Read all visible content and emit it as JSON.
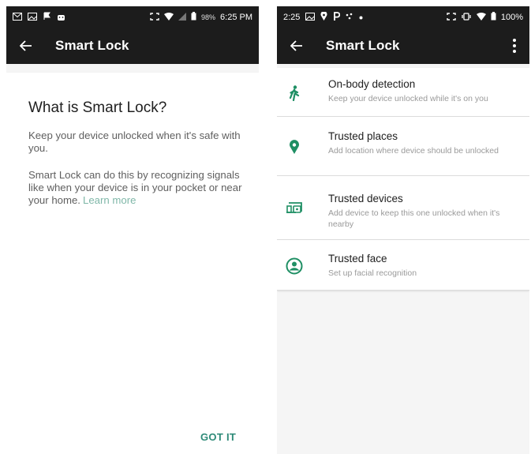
{
  "colors": {
    "toolbar": "#1c1c1c",
    "accent": "#2e8a78",
    "icon_green": "#1f8f64",
    "text_primary": "#202020",
    "text_secondary": "#5f5f5f"
  },
  "left_screen": {
    "status_bar": {
      "left_icons": [
        "mail-icon",
        "image-icon",
        "flag-icon",
        "android-icon"
      ],
      "right_icons": [
        "fullscreen-icon",
        "wifi-icon",
        "signal-icon",
        "battery-icon"
      ],
      "battery": "98%",
      "time": "6:25 PM"
    },
    "app_bar": {
      "title": "Smart Lock"
    },
    "card": {
      "heading": "What is Smart Lock?",
      "paragraph1": "Keep your device unlocked when it's safe with you.",
      "paragraph2": "Smart Lock can do this by recognizing signals like when your device is in your pocket or near your home.",
      "learn_more": "Learn more",
      "got_it": "GOT IT"
    }
  },
  "right_screen": {
    "status_bar": {
      "time": "2:25",
      "left_icons": [
        "image-icon",
        "location-icon",
        "parking-icon",
        "app-icon",
        "dot-icon"
      ],
      "right_icons": [
        "fullscreen-icon",
        "vibrate-icon",
        "wifi-icon",
        "battery-icon"
      ],
      "battery": "100%"
    },
    "app_bar": {
      "title": "Smart Lock"
    },
    "items": [
      {
        "title": "On-body detection",
        "subtitle": "Keep your device unlocked while it's on you",
        "icon": "walking-person-icon"
      },
      {
        "title": "Trusted places",
        "subtitle": "Add location where device should be unlocked",
        "icon": "location-pin-icon"
      },
      {
        "title": "Trusted devices",
        "subtitle": "Add device to keep this one unlocked when it's nearby",
        "icon": "devices-icon"
      },
      {
        "title": "Trusted face",
        "subtitle": "Set up facial recognition",
        "icon": "face-icon"
      }
    ]
  }
}
